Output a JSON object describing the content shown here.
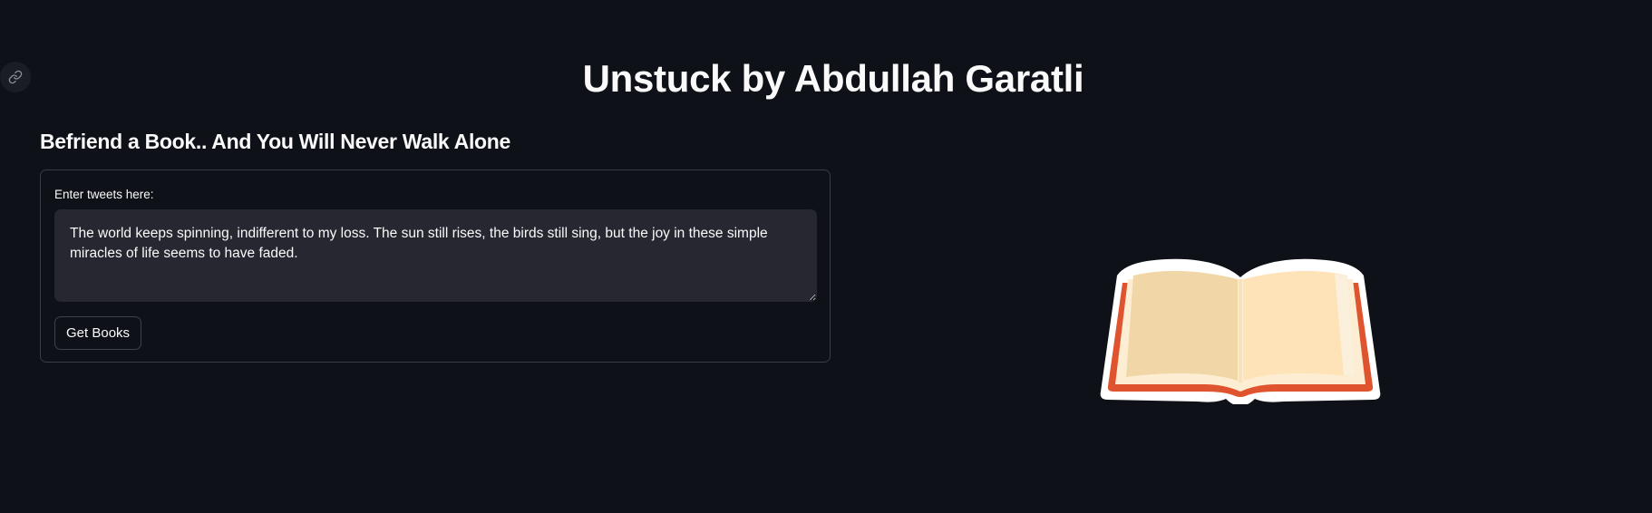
{
  "header": {
    "title": "Unstuck by Abdullah Garatli",
    "anchor_icon": "link-icon"
  },
  "main": {
    "subheader": "Befriend a Book.. And You Will Never Walk Alone",
    "form": {
      "input_label": "Enter tweets here:",
      "input_value": "The world keeps spinning, indifferent to my loss. The sun still rises, the birds still sing, but the joy in these simple miracles of life seems to have faded.",
      "submit_label": "Get Books"
    },
    "illustration_icon": "open-book-icon"
  },
  "colors": {
    "background": "#0e1117",
    "input_background": "#262730",
    "text": "#fafafa",
    "book_cover": "#e0532f",
    "book_page_left": "#f1d7a8",
    "book_page_right": "#fde3b7"
  }
}
